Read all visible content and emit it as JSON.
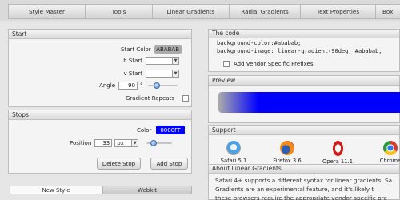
{
  "nav": {
    "tabs": [
      "Style Master",
      "Tools",
      "Linear Gradients",
      "Radial Gradients",
      "Text Properties",
      "Box"
    ]
  },
  "start": {
    "title": "Start",
    "start_color_label": "Start Color",
    "start_color_value": "ABABAB",
    "h_start_label": "h Start",
    "v_start_label": "v Start",
    "angle_label": "Angle",
    "angle_value": "90",
    "angle_unit": "°",
    "angle_slider_fraction": 0.25,
    "gradient_repeats_label": "Gradient Repeats",
    "gradient_repeats_checked": false
  },
  "stops": {
    "title": "Stops",
    "color_label": "Color",
    "color_value": "0000FF",
    "color_hex": "#0000ff",
    "position_label": "Position",
    "position_value": "33",
    "position_unit": "px",
    "position_slider_fraction": 0.2,
    "delete_label": "Delete Stop",
    "add_label": "Add Stop"
  },
  "bottom_tabs": {
    "new_style": "New Style",
    "webkit": "Webkit"
  },
  "code": {
    "title": "The code",
    "line1": "background-color:#ababab;",
    "line2": "background-image: linear-gradient(90deg, #ababab,",
    "vendor_label": "Add Vendor Specific Prefixes"
  },
  "preview": {
    "title": "Preview",
    "from_color": "#ababab",
    "to_color": "#0000ff"
  },
  "support": {
    "title": "Support",
    "browsers": [
      {
        "name": "Safari 5.1",
        "icon": "safari-icon"
      },
      {
        "name": "Firefox 3.6",
        "icon": "firefox-icon"
      },
      {
        "name": "Opera 11.1",
        "icon": "opera-icon"
      },
      {
        "name": "Chrome",
        "icon": "chrome-icon"
      }
    ]
  },
  "about": {
    "title": "About Linear Gradients",
    "line1": "Safari 4+ supports a different syntax for linear gradients. Sa",
    "line2": "Gradients are an experimental feature, and it's likely t",
    "line3": "these browsers require the appropriate vendor specific pre"
  }
}
